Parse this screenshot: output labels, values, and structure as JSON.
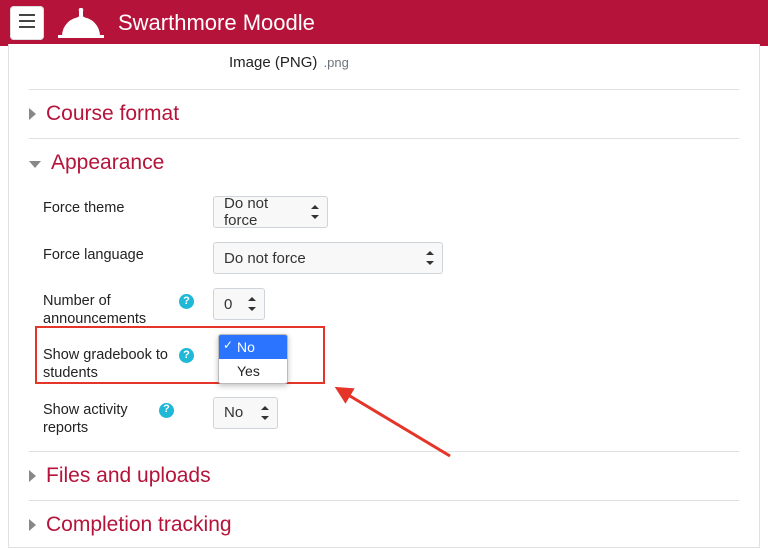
{
  "brand": {
    "title": "Swarthmore Moodle"
  },
  "file_row": {
    "label": "Image (PNG)",
    "ext": ".png"
  },
  "sections": {
    "course_format": {
      "title": "Course format"
    },
    "appearance": {
      "title": "Appearance"
    },
    "files": {
      "title": "Files and uploads"
    },
    "completion": {
      "title": "Completion tracking"
    }
  },
  "appearance": {
    "force_theme": {
      "label": "Force theme",
      "value": "Do not force"
    },
    "force_language": {
      "label": "Force language",
      "value": "Do not force"
    },
    "num_announcements": {
      "label": "Number of announcements",
      "value": "0"
    },
    "show_gradebook": {
      "label": "Show gradebook to students",
      "value": "No",
      "options": {
        "no": "No",
        "yes": "Yes"
      }
    },
    "show_activity": {
      "label": "Show activity reports",
      "value": "No"
    }
  }
}
